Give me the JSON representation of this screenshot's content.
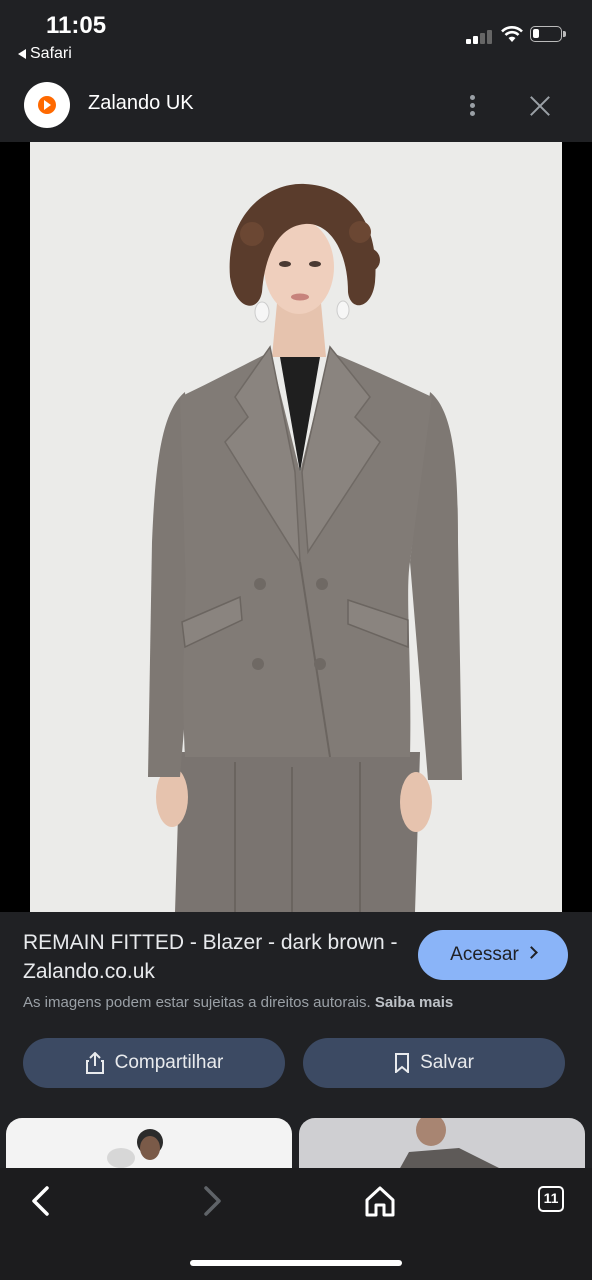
{
  "status_bar": {
    "time": "11:05",
    "back_app_label": "Safari",
    "signal_icon": "cellular-signal-icon",
    "wifi_icon": "wifi-icon",
    "battery_icon": "battery-icon",
    "battery_level": 0.25
  },
  "header": {
    "site_name": "Zalando UK",
    "logo_icon": "zalando-logo-icon",
    "brand_color": "#ff6900",
    "more_icon": "more-vert-icon",
    "close_icon": "close-icon"
  },
  "result": {
    "title": "REMAIN FITTED - Blazer - dark brown - Zalando.co.uk",
    "visit_label": "Acessar",
    "copyright_text": "As imagens podem estar sujeitas a direitos autorais.",
    "learn_more": "Saiba mais",
    "share_label": "Compartilhar",
    "save_label": "Salvar"
  },
  "colors": {
    "background": "#202124",
    "accent": "#8ab4f8",
    "action_button": "#3c4a63",
    "blazer": "#7e7873"
  },
  "toolbar": {
    "back_icon": "back-arrow-icon",
    "forward_icon": "forward-arrow-icon",
    "home_icon": "home-icon",
    "tabs_count": "11"
  }
}
